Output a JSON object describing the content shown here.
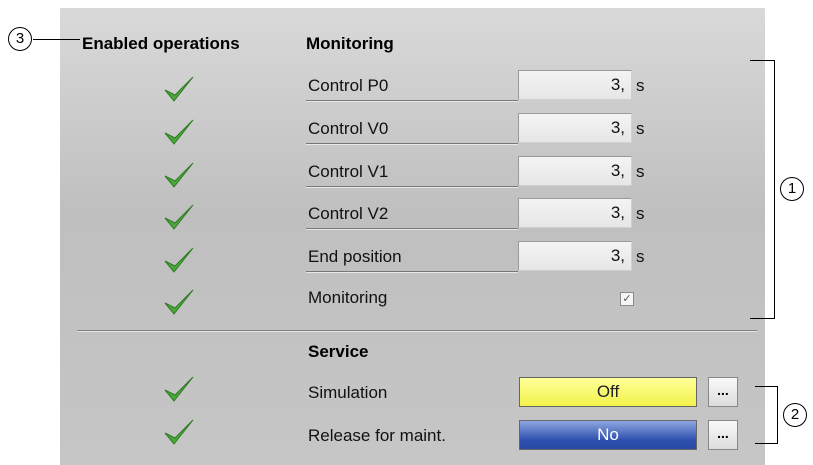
{
  "header": {
    "enabled_operations": "Enabled operations",
    "monitoring": "Monitoring"
  },
  "callouts": {
    "c1": "1",
    "c2": "2",
    "c3": "3"
  },
  "rows": [
    {
      "label": "Control P0",
      "value": "3,",
      "unit": "s"
    },
    {
      "label": "Control V0",
      "value": "3,",
      "unit": "s"
    },
    {
      "label": "Control V1",
      "value": "3,",
      "unit": "s"
    },
    {
      "label": "Control V2",
      "value": "3,",
      "unit": "s"
    },
    {
      "label": "End position",
      "value": "3,",
      "unit": "s"
    }
  ],
  "monitoring_row": {
    "label": "Monitoring",
    "checked": true,
    "check_glyph": "✓"
  },
  "service": {
    "title": "Service",
    "simulation": {
      "label": "Simulation",
      "value": "Off",
      "dots": "..."
    },
    "release": {
      "label": "Release for maint.",
      "value": "No",
      "dots": "..."
    }
  },
  "colors": {
    "check": "#4aa83a",
    "simulation_off": "#f5f55a",
    "release_no": "#2d4fae"
  },
  "icons": {
    "enabled": "checkmark-icon"
  }
}
